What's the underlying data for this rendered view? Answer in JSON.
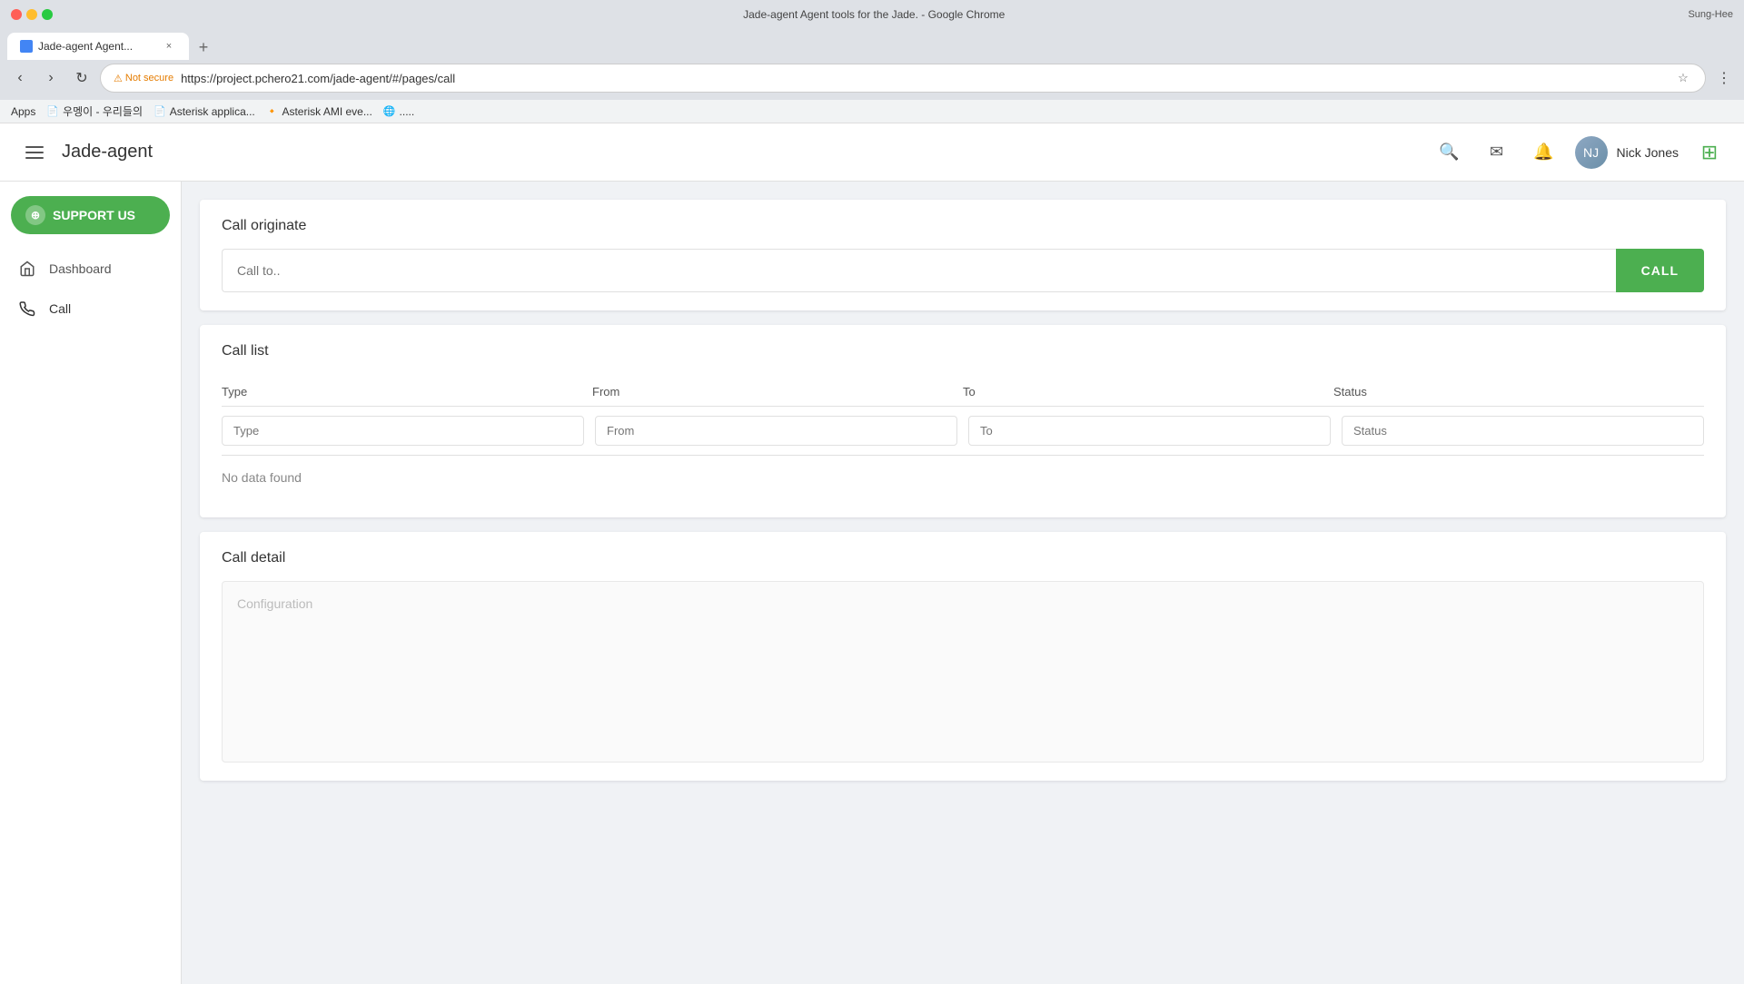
{
  "browser": {
    "title": "Jade-agent Agent tools for the Jade. - Google Chrome",
    "profile": "Sung-Hee",
    "tab": {
      "title": "Jade-agent Agent...",
      "favicon_color": "#4285f4"
    },
    "address": {
      "security_label": "Not secure",
      "url": "https://project.pchero21.com/jade-agent/#/pages/call"
    },
    "bookmarks": [
      {
        "label": "Apps"
      },
      {
        "label": "우멩이 - 우리들의"
      },
      {
        "label": "Asterisk applica..."
      },
      {
        "label": "Asterisk AMI eve..."
      },
      {
        "label": "....."
      }
    ]
  },
  "app": {
    "logo": "Jade-agent",
    "user": {
      "name": "Nick Jones"
    }
  },
  "sidebar": {
    "support_label": "SUPPORT US",
    "nav_items": [
      {
        "id": "dashboard",
        "label": "Dashboard",
        "icon": "⌂"
      },
      {
        "id": "call",
        "label": "Call",
        "icon": "📞"
      }
    ]
  },
  "call_originate": {
    "title": "Call originate",
    "input_placeholder": "Call to..",
    "button_label": "CALL"
  },
  "call_list": {
    "title": "Call list",
    "columns": {
      "type": "Type",
      "from": "From",
      "to": "To",
      "status": "Status"
    },
    "filters": {
      "type_placeholder": "Type",
      "from_placeholder": "From",
      "to_placeholder": "To",
      "status_placeholder": "Status"
    },
    "no_data": "No data found"
  },
  "call_detail": {
    "title": "Call detail",
    "config_placeholder": "Configuration"
  },
  "icons": {
    "search": "🔍",
    "mail": "✉",
    "bell": "🔔",
    "grid": "⊞",
    "hamburger": "☰",
    "github": "⊕"
  }
}
